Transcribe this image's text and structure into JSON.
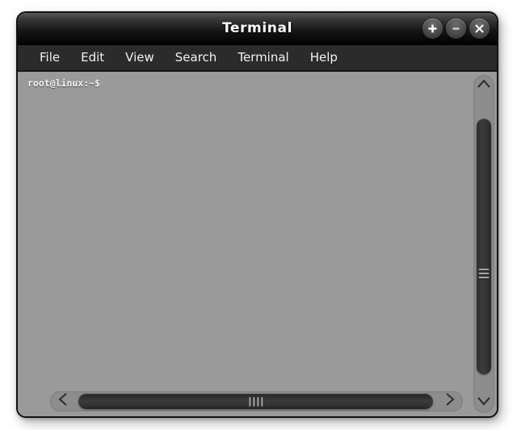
{
  "window": {
    "title": "Terminal",
    "controls": [
      {
        "name": "maximize-button",
        "icon": "plus-icon"
      },
      {
        "name": "minimize-button",
        "icon": "minus-icon"
      },
      {
        "name": "close-button",
        "icon": "close-icon"
      }
    ]
  },
  "menubar": {
    "items": [
      {
        "label": "File"
      },
      {
        "label": "Edit"
      },
      {
        "label": "View"
      },
      {
        "label": "Search"
      },
      {
        "label": "Terminal"
      },
      {
        "label": "Help"
      }
    ]
  },
  "terminal": {
    "lines": [
      "root@linux:~$"
    ],
    "prompt_user": "root",
    "prompt_host": "linux",
    "prompt_path": "~",
    "prompt_symbol": "$"
  },
  "scrollbars": {
    "vertical": {
      "up_arrow_icon": "chevron-up-icon",
      "down_arrow_icon": "chevron-down-icon",
      "grip_lines": 3
    },
    "horizontal": {
      "left_arrow_icon": "chevron-left-icon",
      "right_arrow_icon": "chevron-right-icon",
      "grip_lines": 4
    }
  },
  "colors": {
    "titlebar_top": "#585858",
    "titlebar_bottom": "#000000",
    "menubar_bg": "#2b2b2b",
    "terminal_bg": "#9a9a9a",
    "terminal_fg": "#f4f4f4",
    "scroll_track": "#8d8d8d",
    "scroll_thumb": "#333333",
    "window_border": "#111111",
    "desktop_bg": "#ffffff"
  }
}
